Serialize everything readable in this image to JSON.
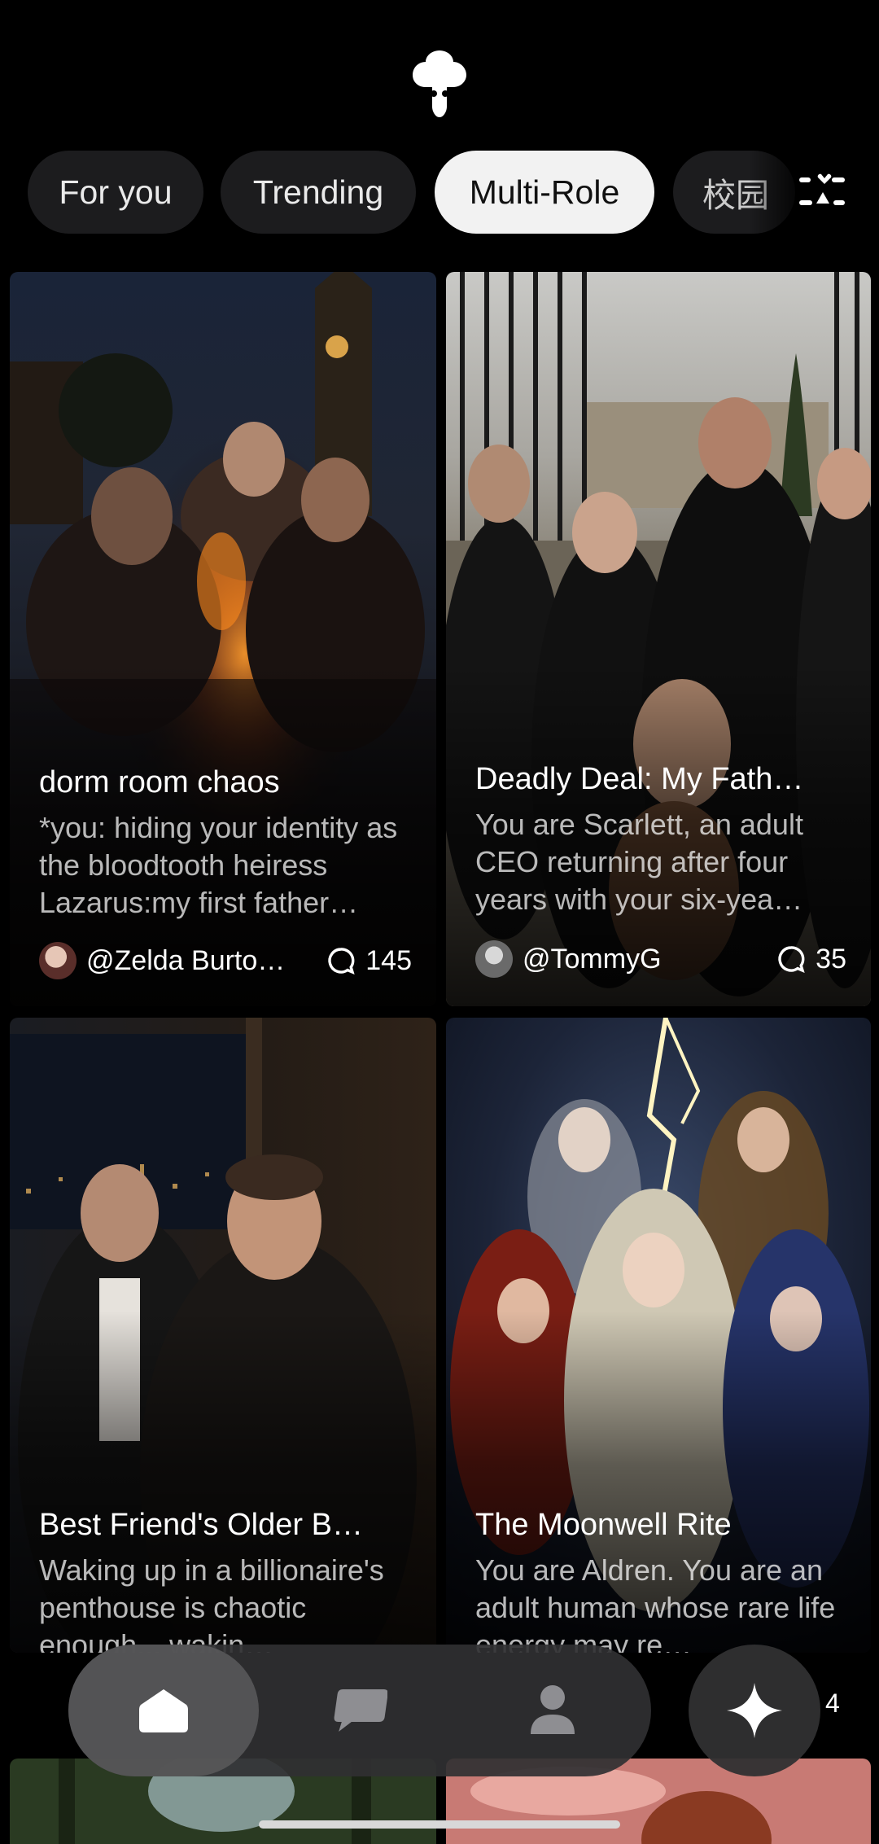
{
  "header": {
    "logo_icon": "mushroom-logo-icon",
    "tabs": [
      {
        "label": "For you",
        "active": false
      },
      {
        "label": "Trending",
        "active": false
      },
      {
        "label": "Multi-Role",
        "active": true
      },
      {
        "label": "校园",
        "active": false
      }
    ],
    "filter_icon": "filter-sliders-icon"
  },
  "cards": [
    {
      "title": "dorm room chaos",
      "description": "*you: hiding your identity as the bloodtooth heiress Lazarus:my first father…",
      "author": "@Zelda Burto…",
      "comments": "145"
    },
    {
      "title": "Deadly Deal: My Fath…",
      "description": "You are Scarlett, an adult CEO returning after four years with your six-yea…",
      "author": "@TommyG",
      "comments": "35"
    },
    {
      "title": "Best Friend's Older B…",
      "description": "Waking up in a billionaire's penthouse is chaotic enough... wakin…"
    },
    {
      "title": "The Moonwell Rite",
      "description": "You are Aldren. You are an adult human whose rare life energy may re…",
      "comments_peek": "4"
    }
  ],
  "nav": {
    "items": [
      {
        "icon": "home-icon",
        "active": true
      },
      {
        "icon": "chat-bubble-icon",
        "active": false
      },
      {
        "icon": "profile-icon",
        "active": false
      }
    ],
    "create_icon": "sparkle-icon"
  },
  "colors": {
    "background": "#000000",
    "tab_inactive": "#1c1c1e",
    "tab_active": "#f2f2f2",
    "nav_bar": "#303032"
  }
}
